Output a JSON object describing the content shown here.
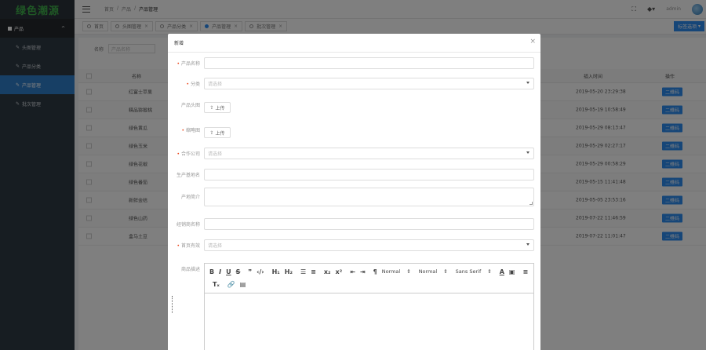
{
  "sidebar": {
    "logo": "绿色潮源",
    "group_label": "产品",
    "items": [
      {
        "label": "头图管理"
      },
      {
        "label": "产品分类"
      },
      {
        "label": "产品管理"
      },
      {
        "label": "批次管理"
      }
    ]
  },
  "header": {
    "breadcrumb": [
      "首页",
      "产品",
      "产品管理"
    ],
    "user": "admin"
  },
  "tabs": {
    "items": [
      {
        "label": "首页"
      },
      {
        "label": "头图管理"
      },
      {
        "label": "产品分类"
      },
      {
        "label": "产品管理"
      },
      {
        "label": "批次管理"
      }
    ],
    "close_all": "标签选项"
  },
  "content": {
    "search_label": "名称",
    "search_placeholder": "产品名称",
    "columns": {
      "name": "名称",
      "time": "插入时间",
      "action": "操作"
    },
    "qr_label": "二维码",
    "rows": [
      {
        "name": "红富士苹果",
        "time": "2019-05-20 23:29:38"
      },
      {
        "name": "精品猕猴桃",
        "time": "2019-05-19 10:58:49"
      },
      {
        "name": "绿色黄瓜",
        "time": "2019-05-29 08:13:47"
      },
      {
        "name": "绿色玉米",
        "time": "2019-05-29 02:27:17"
      },
      {
        "name": "绿色花椒",
        "time": "2019-05-29 00:58:29"
      },
      {
        "name": "绿色番茄",
        "time": "2019-05-15 11:41:48"
      },
      {
        "name": "新鲜金桔",
        "time": "2019-05-05 23:53:16"
      },
      {
        "name": "绿色山药",
        "time": "2019-07-22 11:46:59"
      },
      {
        "name": "盒马土豆",
        "time": "2019-07-22 11:01:47"
      }
    ]
  },
  "modal": {
    "title": "新增",
    "fields": {
      "name": "产品名称",
      "category": "分类",
      "category_placeholder": "请选择",
      "head_image": "产品头图",
      "thumb": "缩略图",
      "company": "合作公司",
      "company_placeholder": "请选择",
      "origin": "生产基地名",
      "intro": "产地简介",
      "merchant": "经销商名称",
      "home_show": "首页有效",
      "home_show_placeholder": "请选择",
      "detail": "商品描述"
    },
    "upload_label": "上传",
    "editor": {
      "heading_select": "Normal",
      "size_select": "Normal",
      "font_select": "Sans Serif"
    }
  }
}
